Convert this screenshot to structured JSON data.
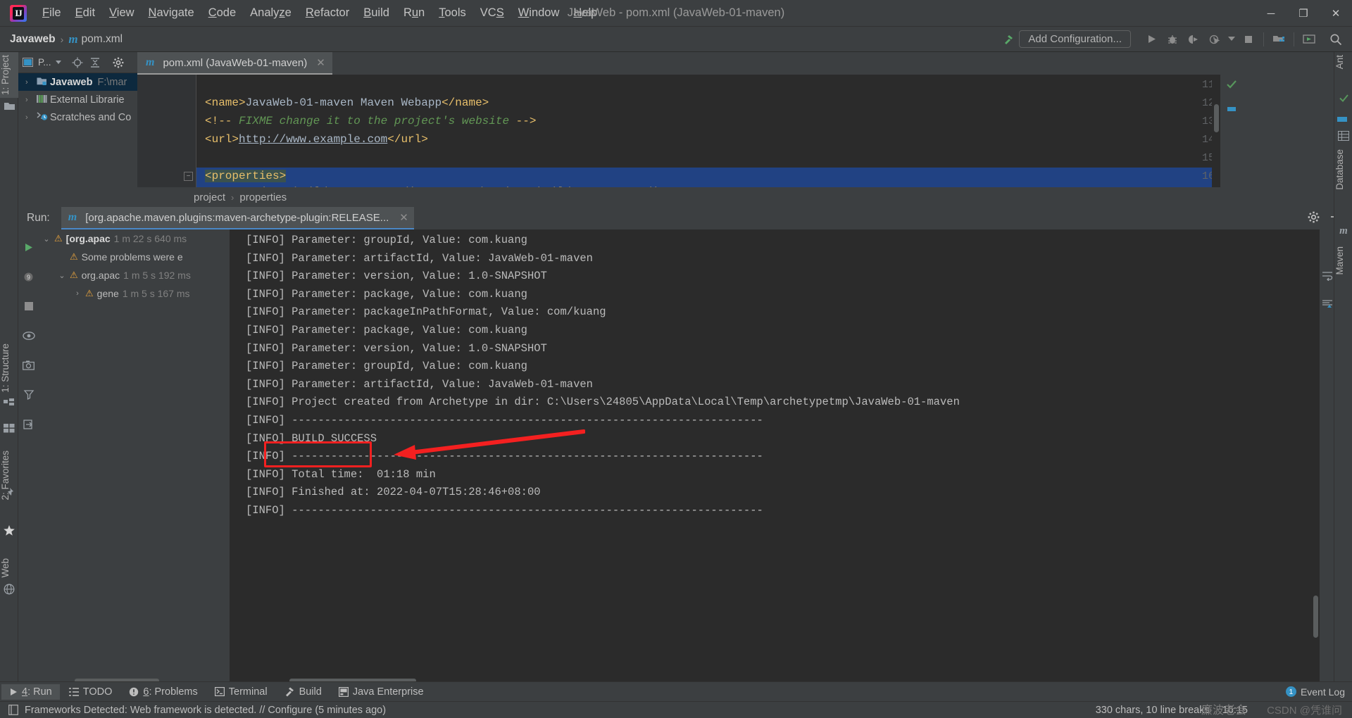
{
  "window": {
    "title": "JavaWeb - pom.xml (JavaWeb-01-maven)",
    "minimize": "─",
    "maximize": "❐",
    "close": "✕"
  },
  "menu": [
    {
      "label": "File",
      "mnemonic": "F"
    },
    {
      "label": "Edit",
      "mnemonic": "E"
    },
    {
      "label": "View",
      "mnemonic": "V"
    },
    {
      "label": "Navigate",
      "mnemonic": "N"
    },
    {
      "label": "Code",
      "mnemonic": "C"
    },
    {
      "label": "Analyze",
      "mnemonic": "z"
    },
    {
      "label": "Refactor",
      "mnemonic": "R"
    },
    {
      "label": "Build",
      "mnemonic": "B"
    },
    {
      "label": "Run",
      "mnemonic": "u"
    },
    {
      "label": "Tools",
      "mnemonic": "T"
    },
    {
      "label": "VCS",
      "mnemonic": "S"
    },
    {
      "label": "Window",
      "mnemonic": "W"
    },
    {
      "label": "Help",
      "mnemonic": "H"
    }
  ],
  "navbar": {
    "crumb_project": "Javaweb",
    "crumb_file": "pom.xml",
    "separator": "›",
    "maven_icon": "m",
    "build_icon": "hammer-icon",
    "add_configuration": "Add Configuration...",
    "icons": [
      "run-icon",
      "debug-icon",
      "run-with-coverage-icon",
      "profiler-icon",
      "dropdown-icon",
      "stop-icon",
      "project-structure-icon",
      "update-icon",
      "search-icon"
    ]
  },
  "left_strip": {
    "project_tab": "1: Project",
    "structure_tab": "1: Structure",
    "favorites_tab": "2: Favorites",
    "web_tab": "Web"
  },
  "right_strip": {
    "ant_tab": "Ant",
    "database_tab": "Database",
    "maven_tab": "Maven"
  },
  "project_panel": {
    "title": "P...",
    "toolbar_icons": [
      "project-view-selector",
      "locate-icon",
      "collapse-all-icon",
      "gear-icon"
    ],
    "tree": [
      {
        "label": "Javaweb",
        "path": "F:\\mar",
        "icon": "module-icon",
        "arrow": "›",
        "selected": true
      },
      {
        "label": "External Librarie",
        "path": "",
        "icon": "libraries-icon",
        "arrow": "›",
        "selected": false
      },
      {
        "label": "Scratches and Co",
        "path": "",
        "icon": "scratches-icon",
        "arrow": "›",
        "selected": false
      }
    ]
  },
  "editor": {
    "tab_label": "pom.xml (JavaWeb-01-maven)",
    "tab_icon": "m",
    "tab_close": "✕",
    "lines": [
      {
        "num": "11",
        "segments": []
      },
      {
        "num": "12",
        "segments": [
          {
            "t": "tag",
            "v": "<name>"
          },
          {
            "t": "text",
            "v": "JavaWeb-01-maven Maven Webapp"
          },
          {
            "t": "tag",
            "v": "</name>"
          }
        ]
      },
      {
        "num": "13",
        "segments": [
          {
            "t": "tag",
            "v": "<!-- "
          },
          {
            "t": "comment",
            "v": "FIXME change it to the project's website"
          },
          {
            "t": "tag",
            "v": " -->"
          }
        ]
      },
      {
        "num": "14",
        "segments": [
          {
            "t": "tag",
            "v": "<url>"
          },
          {
            "t": "link",
            "v": "http://www.example.com"
          },
          {
            "t": "tag",
            "v": "</url>"
          }
        ]
      },
      {
        "num": "15",
        "segments": []
      },
      {
        "num": "16",
        "segments": [
          {
            "t": "tag-hl",
            "v": "<properties>"
          }
        ],
        "selected": true
      }
    ],
    "inspection_status": "✓"
  },
  "breadcrumb": {
    "project": "project",
    "properties": "properties",
    "separator": "›"
  },
  "run_panel": {
    "label": "Run:",
    "tab_icon": "m",
    "tab_title": "[org.apache.maven.plugins:maven-archetype-plugin:RELEASE...",
    "tab_close": "✕",
    "header_icons": [
      "gear-icon",
      "minimize-icon"
    ],
    "side_icons": [
      "rerun-icon",
      "rerun-failed-icon",
      "stop-icon",
      "show-passed-icon",
      "export-icon",
      "settings-icon",
      "pin-icon"
    ],
    "console_icons": [
      "soft-wrap-icon",
      "scroll-to-end-icon"
    ],
    "tree": [
      {
        "label": "[org.apac",
        "time": "1 m 22 s 640 ms",
        "arrow": "⌄",
        "indent": 0,
        "bold": true
      },
      {
        "label": "Some problems were e",
        "time": "",
        "arrow": "",
        "indent": 1,
        "bold": false
      },
      {
        "label": "org.apac",
        "time": "1 m 5 s 192 ms",
        "arrow": "⌄",
        "indent": 1,
        "bold": false
      },
      {
        "label": "gene",
        "time": "1 m 5 s 167 ms",
        "arrow": "›",
        "indent": 2,
        "bold": false
      }
    ],
    "console": [
      "[INFO] Parameter: groupId, Value: com.kuang",
      "[INFO] Parameter: artifactId, Value: JavaWeb-01-maven",
      "[INFO] Parameter: version, Value: 1.0-SNAPSHOT",
      "[INFO] Parameter: package, Value: com.kuang",
      "[INFO] Parameter: packageInPathFormat, Value: com/kuang",
      "[INFO] Parameter: package, Value: com.kuang",
      "[INFO] Parameter: version, Value: 1.0-SNAPSHOT",
      "[INFO] Parameter: groupId, Value: com.kuang",
      "[INFO] Parameter: artifactId, Value: JavaWeb-01-maven",
      "[INFO] Project created from Archetype in dir: C:\\Users\\24805\\AppData\\Local\\Temp\\archetypetmp\\JavaWeb-01-maven",
      "[INFO] ------------------------------------------------------------------------",
      "[INFO] BUILD SUCCESS",
      "[INFO] ------------------------------------------------------------------------",
      "[INFO] Total time:  01:18 min",
      "[INFO] Finished at: 2022-04-07T15:28:46+08:00",
      "[INFO] ------------------------------------------------------------------------"
    ]
  },
  "annotation": {
    "highlight_text": "BUILD SUCCESS",
    "highlight_color": "#f42020"
  },
  "bottom_bar": {
    "items": [
      {
        "label": "4: Run",
        "icon": "run-icon",
        "selected": true
      },
      {
        "label": "TODO",
        "icon": "todo-icon",
        "selected": false
      },
      {
        "label": "6: Problems",
        "icon": "problems-icon",
        "selected": false
      },
      {
        "label": "Terminal",
        "icon": "terminal-icon",
        "selected": false
      },
      {
        "label": "Build",
        "icon": "hammer-icon",
        "selected": false
      },
      {
        "label": "Java Enterprise",
        "icon": "java-enterprise-icon",
        "selected": false
      }
    ],
    "event_log": "Event Log",
    "event_log_count": "1"
  },
  "status_bar": {
    "message": "Frameworks Detected: Web framework is detected. // Configure (5 minutes ago)",
    "chars": "330 chars, 10 line breaks",
    "caret": "16:15",
    "watermark": "CSDN @凭谁问",
    "watermark2": "廉波老会"
  }
}
